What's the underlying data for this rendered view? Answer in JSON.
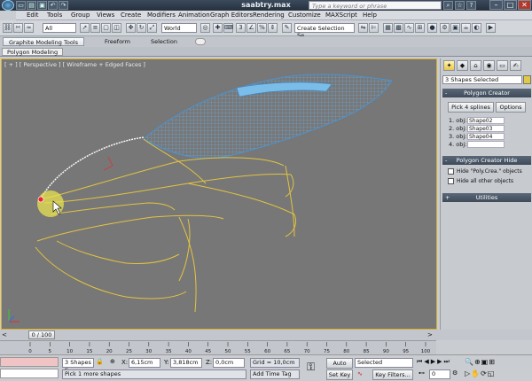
{
  "title": "saabtry.max",
  "search_placeholder": "Type a keyword or phrase",
  "menu": [
    "Edit",
    "Tools",
    "Group",
    "Views",
    "Create",
    "Modifiers",
    "Animation",
    "Graph Editors",
    "Rendering",
    "Customize",
    "MAXScript",
    "Help"
  ],
  "toolbar": {
    "filter": "All",
    "coord": "World",
    "selection_set": "Create Selection Se"
  },
  "ribbon": {
    "tabs": [
      "Graphite Modeling Tools",
      "Freeform",
      "Selection"
    ],
    "subtab": "Polygon Modeling"
  },
  "viewport": {
    "label": "[ + ] [ Perspective ] [ Wireframe + Edged Faces ]"
  },
  "command_panel": {
    "selection": "3 Shapes Selected",
    "rollout1": "Polygon Creator",
    "pick_button": "Pick 4 splines",
    "options_button": "Options",
    "objects": [
      {
        "label": "1. obj:",
        "value": "Shape02"
      },
      {
        "label": "2. obj:",
        "value": "Shape03"
      },
      {
        "label": "3. obj:",
        "value": "Shape04"
      },
      {
        "label": "4. obj:",
        "value": ""
      }
    ],
    "rollout2": "Polygon Creator Hide",
    "hide_poly": "Hide \"Poly.Crea.\" objects",
    "hide_all": "Hide all other objects",
    "rollout3": "Utilities"
  },
  "timeline": {
    "slider": "0 / 100",
    "ticks": [
      "0",
      "5",
      "10",
      "15",
      "20",
      "25",
      "30",
      "35",
      "40",
      "45",
      "50",
      "55",
      "60",
      "65",
      "70",
      "75",
      "80",
      "85",
      "90",
      "95",
      "100"
    ]
  },
  "status": {
    "selected": "3 Shapes S",
    "x": "6,15cm",
    "y": "3,818cm",
    "z": "0,0cm",
    "grid": "Grid = 10,0cm",
    "auto_key": "Auto Key",
    "auto_key_mode": "Selected",
    "set_key": "Set Key",
    "key_filters": "Key Filters...",
    "frame": "0",
    "prompt": "Pick 1 more shapes",
    "add_time_tag": "Add Time Tag",
    "x_label": "X:",
    "y_label": "Y:",
    "z_label": "Z:"
  },
  "colors": {
    "viewport_bg": "#777777",
    "spline": "#e2c440",
    "mesh": "#5aa8e8",
    "selection_border": "#d7b12b"
  }
}
